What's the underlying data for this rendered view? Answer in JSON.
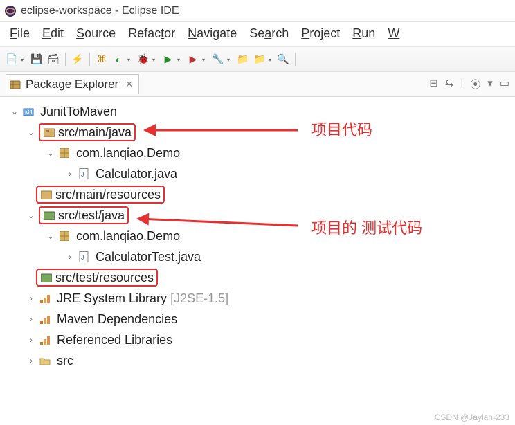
{
  "title": "eclipse-workspace - Eclipse IDE",
  "menu": {
    "file": "File",
    "edit": "Edit",
    "source": "Source",
    "refactor": "Refactor",
    "navigate": "Navigate",
    "search": "Search",
    "project": "Project",
    "run": "Run",
    "window_partial": "W"
  },
  "panel": {
    "title": "Package Explorer"
  },
  "tree": {
    "project": "JunitToMaven",
    "srcMainJava": "src/main/java",
    "pkg1": "com.lanqiao.Demo",
    "file1": "Calculator.java",
    "srcMainRes": "src/main/resources",
    "srcTestJava": "src/test/java",
    "pkg2": "com.lanqiao.Demo",
    "file2": "CalculatorTest.java",
    "srcTestRes": "src/test/resources",
    "jre": "JRE System Library",
    "jreVer": "[J2SE-1.5]",
    "maven": "Maven Dependencies",
    "reflib": "Referenced Libraries",
    "src": "src"
  },
  "annot": {
    "projectCode": "项目代码",
    "testCode": "项目的 测试代码"
  },
  "watermark": "CSDN @Jaylan-233"
}
